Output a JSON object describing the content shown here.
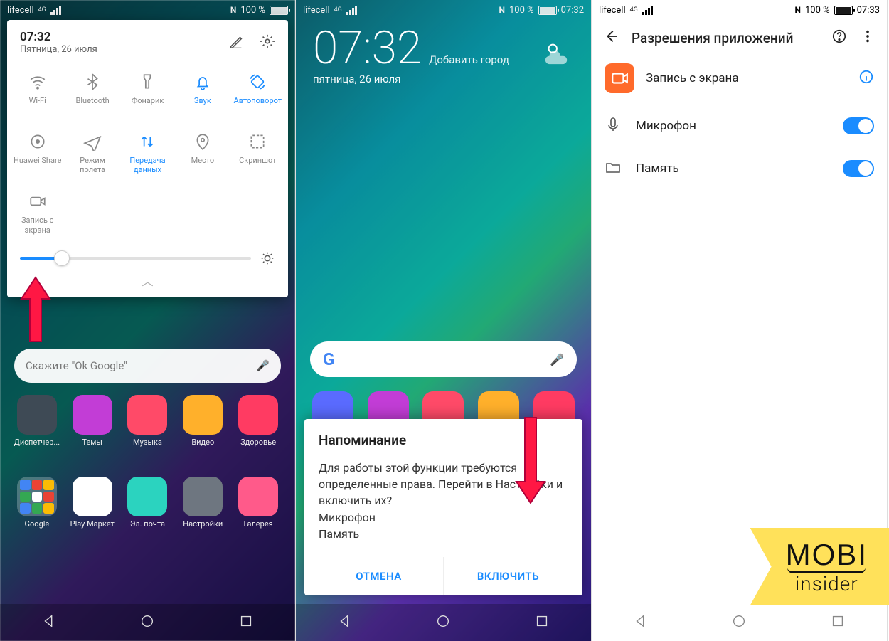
{
  "status": {
    "carrier": "lifecell",
    "net": "4G",
    "nfc": "N",
    "battery": "100 %",
    "time1": "",
    "time2": "07:32",
    "time3": "07:33"
  },
  "qs": {
    "time": "07:32",
    "date": "Пятница, 26 июля",
    "tiles": [
      {
        "label": "Wi-Fi",
        "icon": "wifi",
        "active": false
      },
      {
        "label": "Bluetooth",
        "icon": "bluetooth",
        "active": false
      },
      {
        "label": "Фонарик",
        "icon": "flashlight",
        "active": false
      },
      {
        "label": "Звук",
        "icon": "bell",
        "active": true
      },
      {
        "label": "Автоповорот",
        "icon": "rotate",
        "active": true
      },
      {
        "label": "Huawei Share",
        "icon": "share",
        "active": false
      },
      {
        "label": "Режим\nполета",
        "icon": "plane",
        "active": false
      },
      {
        "label": "Передача\nданных",
        "icon": "data",
        "active": true
      },
      {
        "label": "Место",
        "icon": "location",
        "active": false
      },
      {
        "label": "Скриншот",
        "icon": "screenshot",
        "active": false
      },
      {
        "label": "Запись с\nэкрана",
        "icon": "record",
        "active": false
      }
    ]
  },
  "home1": {
    "search_hint": "Скажите \"Ok Google\"",
    "apps_row1": [
      {
        "label": "Диспетчер...",
        "c": "#3e4a55"
      },
      {
        "label": "Темы",
        "c": "#c23dd6"
      },
      {
        "label": "Музыка",
        "c": "#ff4a68"
      },
      {
        "label": "Видео",
        "c": "#ffb02b"
      },
      {
        "label": "Здоровье",
        "c": "#ff3b62"
      }
    ],
    "apps_row2": [
      {
        "label": "Google",
        "folder": true
      },
      {
        "label": "Play Маркет",
        "c": "#ffffff"
      },
      {
        "label": "Эл. почта",
        "c": "#2bd3bf"
      },
      {
        "label": "Настройки",
        "c": "#6e7680"
      },
      {
        "label": "Галерея",
        "c": "#ff5a8a"
      }
    ]
  },
  "p2": {
    "time": "07:32",
    "add_city": "Добавить город",
    "date": "пятница, 26 июля",
    "dialog": {
      "title": "Напоминание",
      "body": "Для работы этой функции требуются определенные права. Перейти в Настройки и включить их?\nМикрофон\nПамять",
      "cancel": "ОТМЕНА",
      "ok": "ВКЛЮЧИТЬ"
    }
  },
  "p3": {
    "title": "Разрешения приложений",
    "app_name": "Запись с экрана",
    "perms": [
      {
        "label": "Микрофон",
        "icon": "mic",
        "on": true
      },
      {
        "label": "Память",
        "icon": "folder",
        "on": true
      }
    ]
  },
  "watermark": {
    "l1": "MOBI",
    "l2": "insider"
  }
}
